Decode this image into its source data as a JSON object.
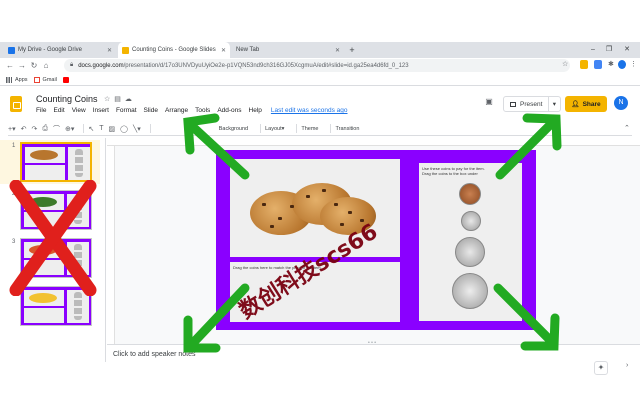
{
  "browser": {
    "tabs": [
      {
        "label": "My Drive - Google Drive",
        "color": "#1a73e8"
      },
      {
        "label": "Counting Coins - Google Slides",
        "color": "#f4b400"
      },
      {
        "label": "New Tab",
        "color": "#9aa0a6"
      }
    ],
    "close_glyph": "✕",
    "newtab_glyph": "+",
    "window_controls": [
      "–",
      "❐",
      "✕"
    ],
    "url_host": "docs.google.com",
    "url_path": "/presentation/d/17o3UNVDyuUyiOe2e-p1VQN53nd9ch316GJ05XcgmuA/edit#slide=id.ga25ea4d6fd_0_123",
    "bookmarks": [
      {
        "label": "Apps",
        "icon": "apps-grid-icon"
      },
      {
        "label": "Gmail",
        "icon": "gmail-icon"
      },
      {
        "label": "",
        "icon": "youtube-icon"
      }
    ]
  },
  "app": {
    "title": "Counting Coins",
    "menus": [
      "File",
      "Edit",
      "View",
      "Insert",
      "Format",
      "Slide",
      "Arrange",
      "Tools",
      "Add-ons",
      "Help"
    ],
    "last_edit": "Last edit was seconds ago",
    "present_label": "Present",
    "share_label": "Share",
    "avatar_letter": "N",
    "accent": "#f4b400",
    "toolbar_text": [
      "Background",
      "Layout▾",
      "Theme",
      "Transition"
    ]
  },
  "slides_panel": {
    "numbers": [
      "1",
      "2",
      "3",
      "4"
    ]
  },
  "slide": {
    "background": "#8a00ff",
    "drop_label": "Drag the coins here to match the price of the item.",
    "instructions_1": "Use these coins to pay for the item.",
    "instructions_2": "Drag the coins to the box under"
  },
  "notes": {
    "placeholder": "Click to add speaker notes"
  },
  "overlay": {
    "arrow_color": "#22aa22",
    "x_color": "#e0201c",
    "watermark": "数创科技scs66"
  }
}
